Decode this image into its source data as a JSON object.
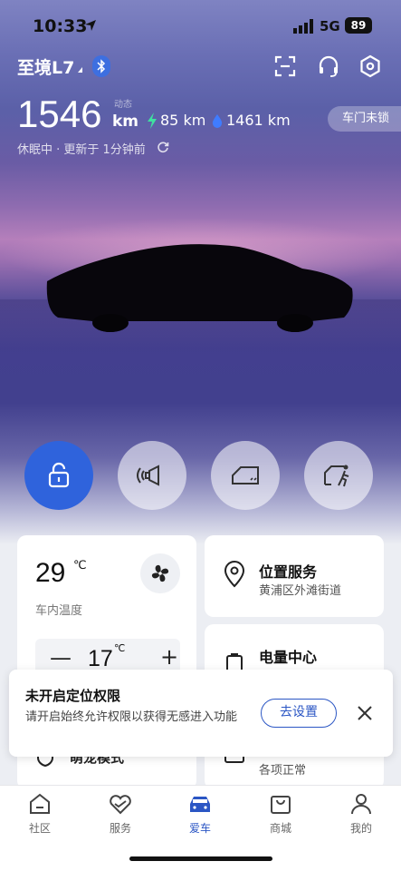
{
  "status_bar": {
    "time": "10:33",
    "network": "5G",
    "battery": "89"
  },
  "header": {
    "car_name": "至境L7",
    "range_total": "1546",
    "range_unit": "km",
    "range_tag": "动态",
    "ev_range": "85 km",
    "fuel_range": "1461 km",
    "door_status": "车门未锁",
    "sleep_status": "休眠中 · 更新于 1分钟前"
  },
  "controls": [
    {
      "name": "lock",
      "icon": "lock-icon",
      "active": true
    },
    {
      "name": "horn",
      "icon": "horn-icon",
      "active": false
    },
    {
      "name": "window",
      "icon": "window-icon",
      "active": false
    },
    {
      "name": "trunk",
      "icon": "trunk-icon",
      "active": false
    }
  ],
  "climate_card": {
    "temp": "29",
    "temp_unit": "℃",
    "label": "车内温度",
    "set_temp": "17",
    "set_unit": "℃",
    "minus": "—",
    "plus": "+"
  },
  "location_card": {
    "title": "位置服务",
    "subtitle": "黄浦区外滩街道"
  },
  "energy_card": {
    "title": "电量中心"
  },
  "mode_card": {
    "title": "萌宠模式"
  },
  "status_card": {
    "subtitle": "各项正常"
  },
  "toast": {
    "title": "未开启定位权限",
    "body": "请开启始终允许权限以获得无感进入功能",
    "button": "去设置"
  },
  "tabs": [
    {
      "label": "社区",
      "icon": "home-icon",
      "active": false
    },
    {
      "label": "服务",
      "icon": "heart-hand-icon",
      "active": false
    },
    {
      "label": "爱车",
      "icon": "car-icon",
      "active": true
    },
    {
      "label": "商城",
      "icon": "bag-icon",
      "active": false
    },
    {
      "label": "我的",
      "icon": "person-icon",
      "active": false
    }
  ],
  "colors": {
    "accent": "#2b56c4",
    "lock_active": "#2f63dc"
  }
}
